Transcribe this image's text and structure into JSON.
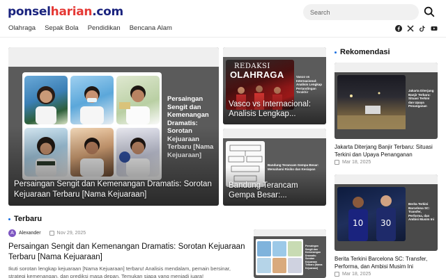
{
  "header": {
    "logo": {
      "part1": "ponsel",
      "part2": "harian",
      "part3": ".com"
    },
    "search_placeholder": "Search"
  },
  "nav": [
    "Olahraga",
    "Sepak Bola",
    "Pendidikan",
    "Bencana Alam"
  ],
  "socials": [
    "facebook-icon",
    "x-icon",
    "tiktok-icon",
    "youtube-icon"
  ],
  "hero": {
    "title": "Persaingan Sengit dan Kemenangan Dramatis: Sorotan Kejuaraan Terbaru [Nama Kejuaraan]",
    "image_caption": "Persaingan Sengit dan Kemenangan Dramatis: Sorotan Kejuaraan Terbaru [Nama Kejuaraan]"
  },
  "card_top": {
    "title": "Vasco vs Internacional: Analisis Lengkap...",
    "image_brand": "REDAKSI",
    "image_brand2": "OLAHRAGA",
    "image_caption": "Vasco vs Internacional: Analisis Lengkap Pertandingan Terakhir"
  },
  "card_bottom": {
    "title": "Bandung Terancam Gempa Besar:...",
    "image_caption": "Bandung Terancam Gempa Besar: Memahami Risiko dan Kesiapan"
  },
  "terbaru": {
    "heading": "Terbaru",
    "author": "Alexander",
    "avatar_letter": "A",
    "date": "Nov 29, 2025",
    "title": "Persaingan Sengit dan Kemenangan Dramatis: Sorotan Kejuaraan Terbaru [Nama Kejuaraan]",
    "excerpt": "Ikuti sorotan lengkap kejuaraan [Nama Kejuaraan] terbaru! Analisis mendalam, pemain bersinar, strategi kemenangan, dan prediksi masa depan. Temukan siapa yang menjadi juara!",
    "thumb_caption": "Persaingan Sengit dan Kemenangan Dramatis: Sorotan Kejuaraan Terbaru [Nama Kejuaraan]"
  },
  "rekomendasi": {
    "heading": "Rekomendasi",
    "items": [
      {
        "title": "Jakarta Diterjang Banjir Terbaru: Situasi Terkini dan Upaya Penanganan",
        "date": "Mar 18, 2025",
        "thumb_caption": "Jakarta Diterjang Banjir Terbaru: Situasi Terkini dan Upaya Penanganan"
      },
      {
        "title": "Berita Terkini Barcelona SC: Transfer, Performa, dan Ambisi Musim Ini",
        "date": "Mar 18, 2025",
        "thumb_caption": "Berita Terkini Barcelona SC: Transfer, Performa, dan Ambisi Musim Ini"
      }
    ]
  },
  "colors": {
    "brand_dark": "#1a237e",
    "brand_red": "#e53935",
    "accent": "#1a6fe0"
  }
}
